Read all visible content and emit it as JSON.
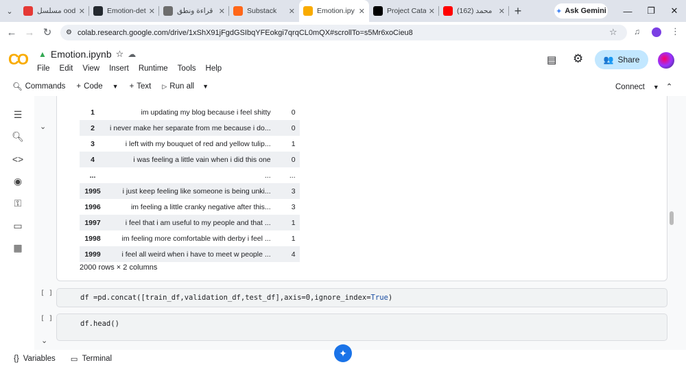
{
  "tabs": [
    {
      "title": "مسلسل ood",
      "fav_color": "#e53935"
    },
    {
      "title": "Emotion-det",
      "fav_color": "#24292f"
    },
    {
      "title": "قراءة ونطق",
      "fav_color": "#6d6d6d"
    },
    {
      "title": "Substack",
      "fav_color": "#ff6719"
    },
    {
      "title": "Emotion.ipy",
      "fav_color": "#f9ab00"
    },
    {
      "title": "Project Cata",
      "fav_color": "#000000"
    },
    {
      "title": "(162) محمد",
      "fav_color": "#ff0000"
    }
  ],
  "ask_gemini": "Ask Gemini",
  "url": "colab.research.google.com/drive/1xShX91jFgdGSIbqYFEokgi7qrqCL0mQX#scrollTo=s5Mr6xoCieu8",
  "logo": "CO",
  "file_name": "Emotion.ipynb",
  "menu": [
    "File",
    "Edit",
    "View",
    "Insert",
    "Runtime",
    "Tools",
    "Help"
  ],
  "share_label": "Share",
  "toolbar": {
    "commands": "Commands",
    "code": "Code",
    "text": "Text",
    "run_all": "Run all",
    "connect": "Connect"
  },
  "df_rows": [
    {
      "idx": "1",
      "text": "im updating my blog because i feel shitty",
      "label": "0"
    },
    {
      "idx": "2",
      "text": "i never make her separate from me because i do...",
      "label": "0"
    },
    {
      "idx": "3",
      "text": "i left with my bouquet of red and yellow tulip...",
      "label": "1"
    },
    {
      "idx": "4",
      "text": "i was feeling a little vain when i did this one",
      "label": "0"
    },
    {
      "idx": "...",
      "text": "...",
      "label": "..."
    },
    {
      "idx": "1995",
      "text": "i just keep feeling like someone is being unki...",
      "label": "3"
    },
    {
      "idx": "1996",
      "text": "im feeling a little cranky negative after this...",
      "label": "3"
    },
    {
      "idx": "1997",
      "text": "i feel that i am useful to my people and that ...",
      "label": "1"
    },
    {
      "idx": "1998",
      "text": "im feeling more comfortable with derby i feel ...",
      "label": "1"
    },
    {
      "idx": "1999",
      "text": "i feel all weird when i have to meet w people ...",
      "label": "4"
    }
  ],
  "df_shape": "2000 rows × 2 columns",
  "cell1_prefix": "df =pd.concat([train_df,validation_df,test_df],axis=0,ignore_index=",
  "cell1_true": "True",
  "cell1_suffix": ")",
  "cell2": "df.head()",
  "bracket": "[ ]",
  "bottom": {
    "variables": "Variables",
    "terminal": "Terminal"
  }
}
